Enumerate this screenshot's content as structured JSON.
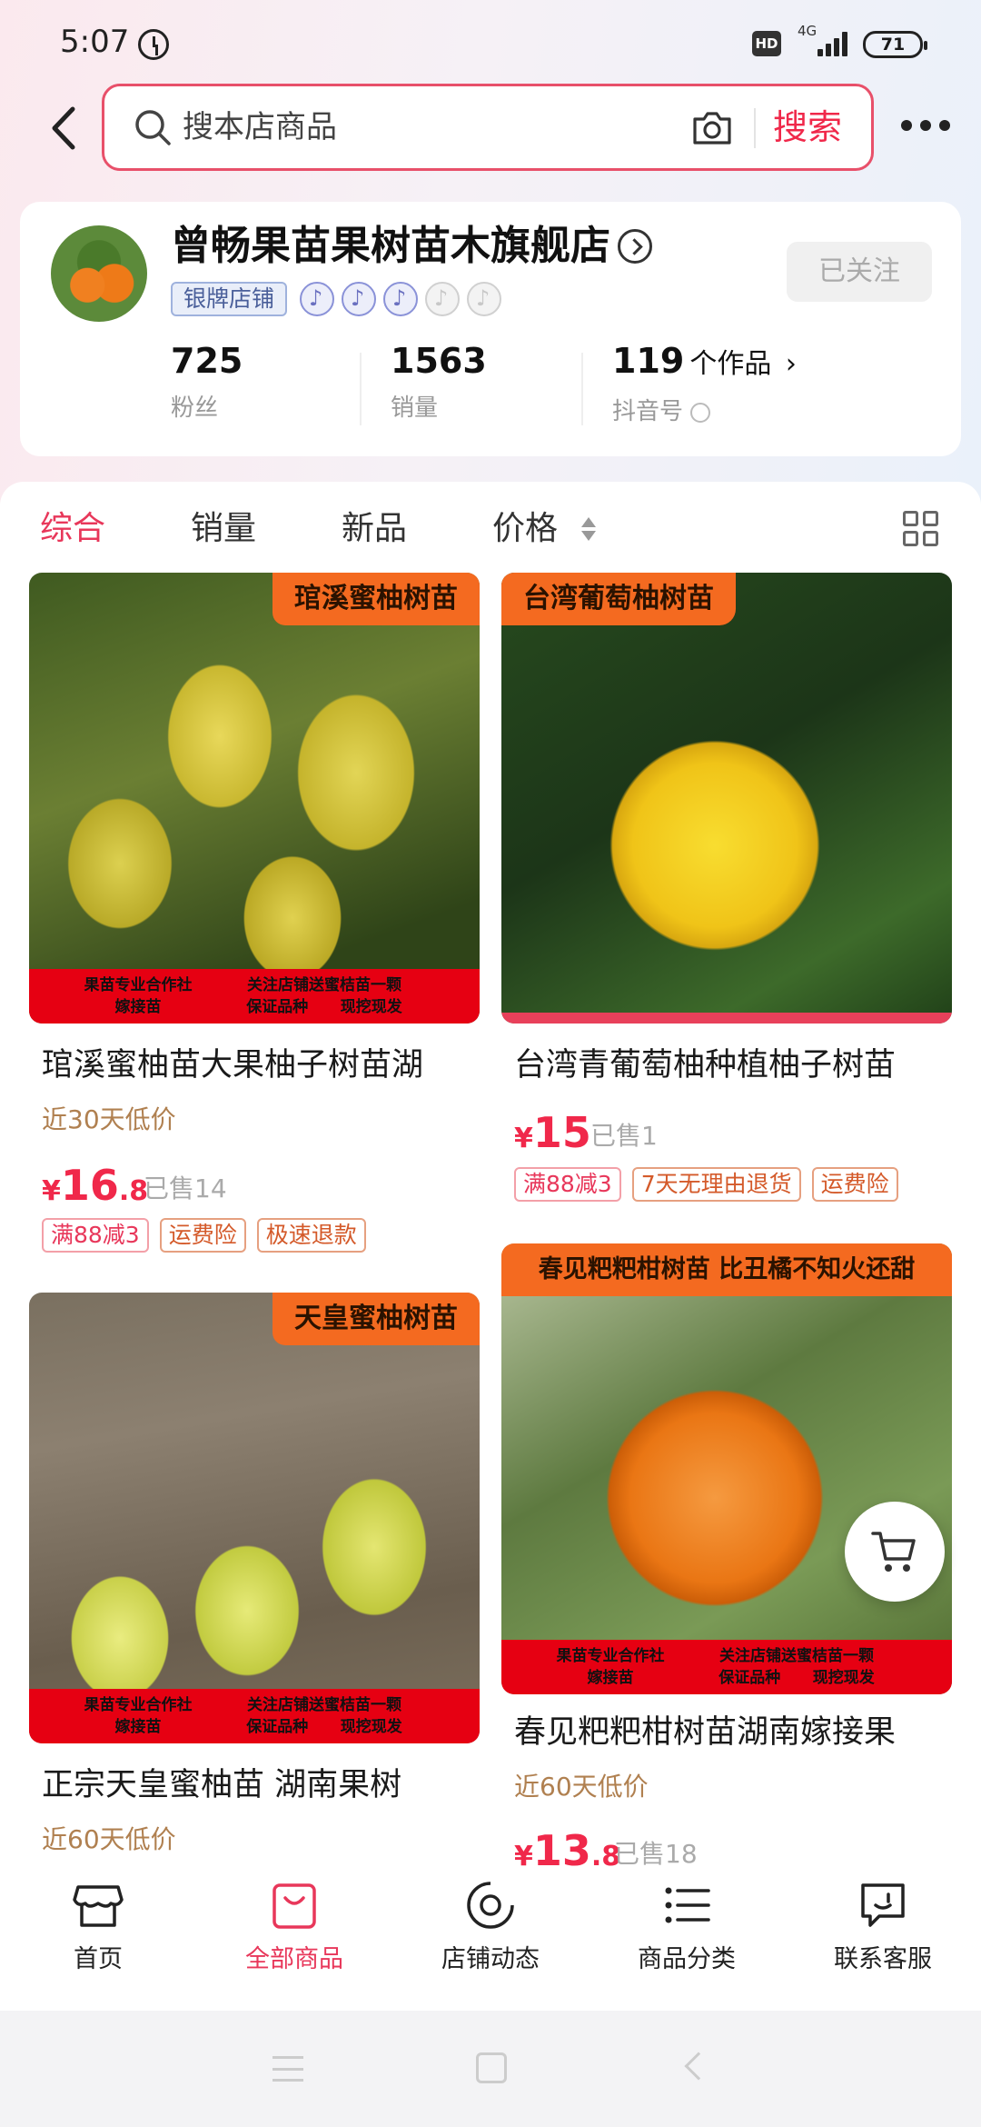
{
  "status_bar": {
    "time": "5:07",
    "hd": "HD",
    "network": "4G",
    "battery": "71"
  },
  "search": {
    "placeholder": "搜本店商品",
    "button": "搜索"
  },
  "shop": {
    "name": "曾畅果苗果树苗木旗舰店",
    "badge": "银牌店铺",
    "follow": "已关注",
    "stats": [
      {
        "value": "725",
        "label": "粉丝"
      },
      {
        "value": "1563",
        "label": "销量"
      },
      {
        "value": "119",
        "unit": "个作品",
        "label": "抖音号"
      }
    ]
  },
  "tabs": [
    "综合",
    "销量",
    "新品",
    "价格"
  ],
  "products": [
    {
      "image_tag": "琯溪蜜柚树苗",
      "band": [
        "果苗专业合作社",
        "关注店铺送蜜桔苗一颗",
        "嫁接苗",
        "保证品种",
        "现挖现发"
      ],
      "title": "琯溪蜜柚苗大果柚子树苗湖",
      "low_price_note": "近30天低价",
      "price_int": "16",
      "price_dec": ".8",
      "sold": "已售14",
      "tags": [
        "满88减3",
        "运费险",
        "极速退款"
      ]
    },
    {
      "image_tag": "台湾葡萄柚树苗",
      "title": "台湾青葡萄柚种植柚子树苗",
      "price_int": "15",
      "price_dec": "",
      "sold": "已售1",
      "tags": [
        "满88减3",
        "7天无理由退货",
        "运费险"
      ]
    },
    {
      "image_tag": "天皇蜜柚树苗",
      "band": [
        "果苗专业合作社",
        "关注店铺送蜜桔苗一颗",
        "嫁接苗",
        "保证品种",
        "现挖现发"
      ],
      "title": "正宗天皇蜜柚苗 湖南果树",
      "low_price_note": "近60天低价"
    },
    {
      "image_tag": "春见粑粑柑树苗 比丑橘不知火还甜",
      "band": [
        "果苗专业合作社",
        "关注店铺送蜜桔苗一颗",
        "嫁接苗",
        "保证品种",
        "现挖现发"
      ],
      "title": "春见粑粑柑树苗湖南嫁接果",
      "low_price_note": "近60天低价",
      "price_int": "13",
      "price_dec": ".8",
      "sold": "已售18"
    }
  ],
  "currency": "¥",
  "bottom_nav": [
    "首页",
    "全部商品",
    "店铺动态",
    "商品分类",
    "联系客服"
  ],
  "colors": {
    "accent": "#e8375a",
    "price": "#f0284a",
    "band": "#e60012",
    "image_tag": "#f46a20"
  }
}
